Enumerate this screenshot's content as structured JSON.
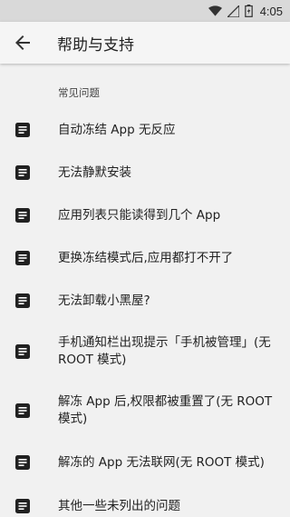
{
  "status_bar": {
    "time": "4:05",
    "icons": [
      "wifi-icon",
      "signal-icon",
      "battery-charging-icon"
    ]
  },
  "app_bar": {
    "back_icon": "arrow-back-icon",
    "title": "帮助与支持"
  },
  "section": {
    "header": "常见问题"
  },
  "faq": {
    "icon": "article-icon",
    "items": [
      {
        "label": "自动冻结 App 无反应"
      },
      {
        "label": "无法静默安装"
      },
      {
        "label": "应用列表只能读得到几个 App"
      },
      {
        "label": "更换冻结模式后,应用都打不开了"
      },
      {
        "label": "无法卸载小黑屋?"
      },
      {
        "label": "手机通知栏出现提示「手机被管理」(无 ROOT 模式)"
      },
      {
        "label": "解冻 App 后,权限都被重置了(无 ROOT 模式)"
      },
      {
        "label": "解冻的 App 无法联网(无 ROOT 模式)"
      },
      {
        "label": "其他一些未列出的问题"
      }
    ]
  },
  "colors": {
    "background": "#f1f1f1",
    "status_bar": "#d9d9d9",
    "icon": "#212121"
  }
}
